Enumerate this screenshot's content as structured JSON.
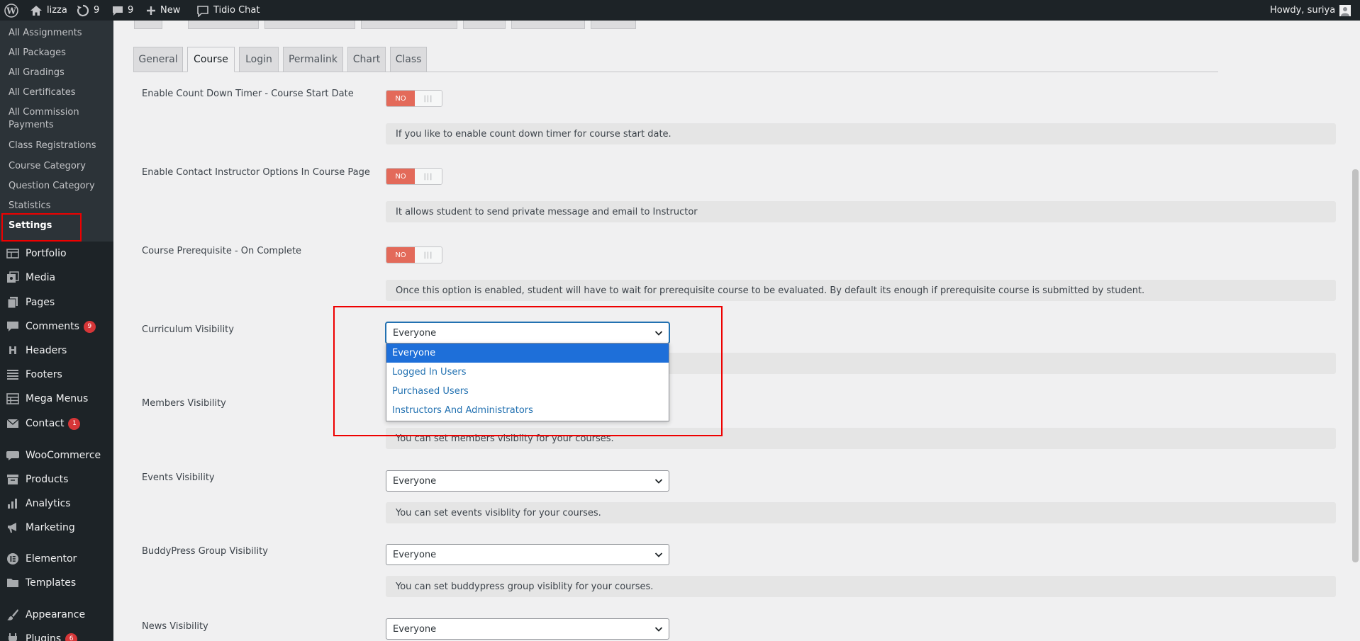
{
  "adminbar": {
    "site_name": "lizza",
    "updates_count": "9",
    "comments_count": "9",
    "new_label": "New",
    "tidio_label": "Tidio Chat",
    "howdy": "Howdy, suriya"
  },
  "submenu": [
    "All Assignments",
    "All Packages",
    "All Gradings",
    "All Certificates",
    "All Commission Payments",
    "Class Registrations",
    "Course Category",
    "Question Category",
    "Statistics",
    "Settings"
  ],
  "menu": {
    "portfolio": "Portfolio",
    "media": "Media",
    "pages": "Pages",
    "comments": "Comments",
    "comments_badge": "9",
    "headers": "Headers",
    "footers": "Footers",
    "mega_menus": "Mega Menus",
    "contact": "Contact",
    "contact_badge": "1",
    "woocommerce": "WooCommerce",
    "products": "Products",
    "analytics": "Analytics",
    "marketing": "Marketing",
    "elementor": "Elementor",
    "templates": "Templates",
    "appearance": "Appearance",
    "plugins": "Plugins",
    "plugins_badge": "6"
  },
  "tabs": [
    "General",
    "Course",
    "Login",
    "Permalink",
    "Chart",
    "Class"
  ],
  "settings": {
    "countdown": {
      "label": "Enable Count Down Timer - Course Start Date",
      "toggle": "NO",
      "desc": "If you like to enable count down timer for course start date."
    },
    "contact_instructor": {
      "label": "Enable Contact Instructor Options In Course Page",
      "toggle": "NO",
      "desc": "It allows student to send private message and email to Instructor"
    },
    "prerequisite": {
      "label": "Course Prerequisite - On Complete",
      "toggle": "NO",
      "desc": "Once this option is enabled, student will have to wait for prerequisite course to be evaluated. By default its enough if prerequisite course is submitted by student."
    },
    "curriculum": {
      "label": "Curriculum Visibility",
      "value": "Everyone",
      "options": [
        "Everyone",
        "Logged In Users",
        "Purchased Users",
        "Instructors And Administrators"
      ]
    },
    "members": {
      "label": "Members Visibility",
      "desc": "You can set members visiblity for your courses."
    },
    "events": {
      "label": "Events Visibility",
      "value": "Everyone",
      "desc": "You can set events visiblity for your courses."
    },
    "buddypress": {
      "label": "BuddyPress Group Visibility",
      "value": "Everyone",
      "desc": "You can set buddypress group visiblity for your courses."
    },
    "news": {
      "label": "News Visibility",
      "value": "Everyone"
    }
  }
}
